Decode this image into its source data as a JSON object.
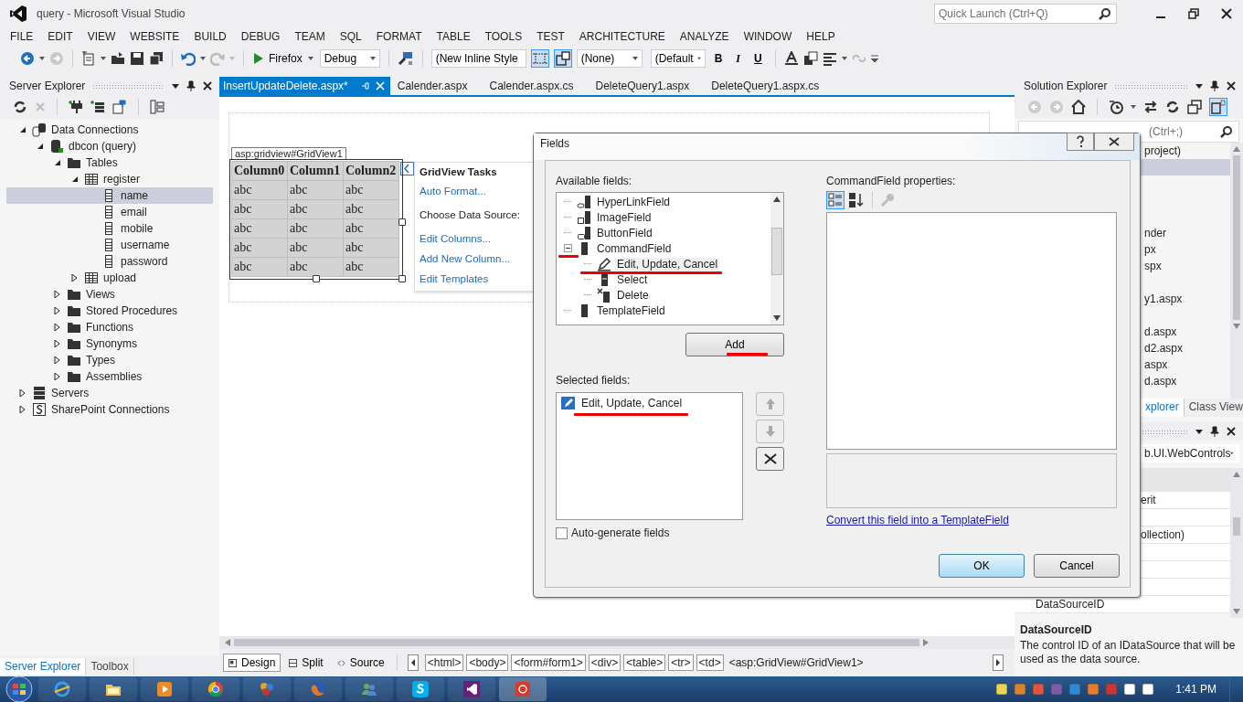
{
  "window": {
    "title": "query - Microsoft Visual Studio",
    "quick_launch": {
      "placeholder": "Quick Launch (Ctrl+Q)"
    }
  },
  "menu": [
    "FILE",
    "EDIT",
    "VIEW",
    "WEBSITE",
    "BUILD",
    "DEBUG",
    "TEAM",
    "SQL",
    "FORMAT",
    "TABLE",
    "TOOLS",
    "TEST",
    "ARCHITECTURE",
    "ANALYZE",
    "WINDOW",
    "HELP"
  ],
  "toolbar": {
    "run_target": "Firefox",
    "configuration": "Debug",
    "style": "(New Inline Style",
    "target_rule": "(None)",
    "font": "(Default",
    "bold": "B",
    "italic": "I",
    "underline": "U"
  },
  "server_explorer": {
    "title": "Server Explorer",
    "tree": [
      {
        "label": "Data Connections",
        "kind": "connections",
        "expanded": true,
        "selected": false,
        "children": [
          {
            "label": "dbcon (query)",
            "kind": "database",
            "expanded": true,
            "selected": false,
            "children": [
              {
                "label": "Tables",
                "kind": "folder",
                "expanded": true,
                "selected": false,
                "children": [
                  {
                    "label": "register",
                    "kind": "table",
                    "expanded": true,
                    "selected": false,
                    "children": [
                      {
                        "label": "name",
                        "kind": "column",
                        "selected": true
                      },
                      {
                        "label": "email",
                        "kind": "column",
                        "selected": false
                      },
                      {
                        "label": "mobile",
                        "kind": "column",
                        "selected": false
                      },
                      {
                        "label": "username",
                        "kind": "column",
                        "selected": false
                      },
                      {
                        "label": "password",
                        "kind": "column",
                        "selected": false
                      }
                    ]
                  },
                  {
                    "label": "upload",
                    "kind": "table",
                    "expanded": false,
                    "selected": false
                  }
                ]
              },
              {
                "label": "Views",
                "kind": "folder",
                "expanded": false,
                "selected": false
              },
              {
                "label": "Stored Procedures",
                "kind": "folder",
                "expanded": false,
                "selected": false
              },
              {
                "label": "Functions",
                "kind": "folder",
                "expanded": false,
                "selected": false
              },
              {
                "label": "Synonyms",
                "kind": "folder",
                "expanded": false,
                "selected": false
              },
              {
                "label": "Types",
                "kind": "folder",
                "expanded": false,
                "selected": false
              },
              {
                "label": "Assemblies",
                "kind": "folder",
                "expanded": false,
                "selected": false
              }
            ]
          }
        ]
      },
      {
        "label": "Servers",
        "kind": "server",
        "expanded": false,
        "selected": false
      },
      {
        "label": "SharePoint Connections",
        "kind": "sharepoint",
        "expanded": false,
        "selected": false
      }
    ]
  },
  "left_tabs": [
    {
      "label": "Server Explorer",
      "selected": true
    },
    {
      "label": "Toolbox",
      "selected": false
    }
  ],
  "tabs": [
    {
      "label": "InsertUpdateDelete.aspx*",
      "selected": true
    },
    {
      "label": "Calender.aspx",
      "selected": false
    },
    {
      "label": "Calender.aspx.cs",
      "selected": false
    },
    {
      "label": "DeleteQuery1.aspx",
      "selected": false
    },
    {
      "label": "DeleteQuery1.aspx.cs",
      "selected": false
    }
  ],
  "designer": {
    "tag": "asp:gridview#GridView1",
    "grid": {
      "columns": [
        "Column0",
        "Column1",
        "Column2"
      ],
      "rows": [
        [
          "abc",
          "abc",
          "abc"
        ],
        [
          "abc",
          "abc",
          "abc"
        ],
        [
          "abc",
          "abc",
          "abc"
        ],
        [
          "abc",
          "abc",
          "abc"
        ],
        [
          "abc",
          "abc",
          "abc"
        ]
      ]
    },
    "tasks": {
      "title": "GridView Tasks",
      "items": [
        {
          "kind": "link",
          "label": "Auto Format..."
        },
        {
          "kind": "dropdown",
          "label": "Choose Data Source:"
        },
        {
          "kind": "link",
          "label": "Edit Columns..."
        },
        {
          "kind": "link",
          "label": "Add New Column..."
        },
        {
          "kind": "link",
          "label": "Edit Templates"
        }
      ]
    }
  },
  "view_buttons": [
    {
      "label": "Design",
      "selected": true
    },
    {
      "label": "Split",
      "selected": false
    },
    {
      "label": "Source",
      "selected": false
    }
  ],
  "breadcrumbs": [
    {
      "label": "<html>",
      "selected": false
    },
    {
      "label": "<body>",
      "selected": false
    },
    {
      "label": "<form#form1>",
      "selected": false
    },
    {
      "label": "<div>",
      "selected": false
    },
    {
      "label": "<table>",
      "selected": false
    },
    {
      "label": "<tr>",
      "selected": false
    },
    {
      "label": "<td>",
      "selected": false
    },
    {
      "label": "<asp:GridView#GridView1>",
      "selected": true
    }
  ],
  "solution_explorer": {
    "title": "Solution Explorer",
    "search": {
      "placeholder": "(Ctrl+;)"
    },
    "items": [
      {
        "label": "project)",
        "selected": false
      },
      {
        "selected": true
      },
      {
        "selected": false
      },
      {
        "selected": false
      },
      {
        "selected": false
      },
      {
        "label": "nder",
        "selected": false
      },
      {
        "label": "px",
        "selected": false
      },
      {
        "label": "spx",
        "selected": false
      },
      {
        "selected": false
      },
      {
        "label": "y1.aspx",
        "selected": false
      },
      {
        "selected": false
      },
      {
        "label": "d.aspx",
        "selected": false
      },
      {
        "label": "d2.aspx",
        "selected": false
      },
      {
        "label": "aspx",
        "selected": false
      },
      {
        "label": "d.aspx",
        "selected": false
      }
    ],
    "tabs": [
      {
        "label": "xplorer",
        "selected": true
      },
      {
        "label": "Class View",
        "selected": false
      }
    ]
  },
  "properties": {
    "object": "b.UI.WebControls",
    "rows": [
      {
        "name": "erit"
      },
      {},
      {
        "name": "ollection)"
      },
      {},
      {},
      {},
      {
        "name": "DataSourceID"
      }
    ],
    "description": {
      "title": "DataSourceID",
      "text": "The control ID of an IDataSource that will be used as the data source."
    }
  },
  "fields_dialog": {
    "title": "Fields",
    "available_label": "Available fields:",
    "available_fields": [
      {
        "label": "HyperLinkField",
        "kind": "hyperlink",
        "selected": false
      },
      {
        "label": "ImageField",
        "kind": "image",
        "selected": false
      },
      {
        "label": "ButtonField",
        "kind": "button",
        "selected": false
      },
      {
        "label": "CommandField",
        "kind": "command",
        "expanded": true,
        "selected": false,
        "children": [
          {
            "label": "Edit, Update, Cancel",
            "kind": "edit",
            "selected": true
          },
          {
            "label": "Select",
            "kind": "select",
            "selected": false
          },
          {
            "label": "Delete",
            "kind": "delete",
            "selected": false
          }
        ]
      },
      {
        "label": "TemplateField",
        "kind": "template",
        "selected": false
      }
    ],
    "add_button": "Add",
    "selected_label": "Selected fields:",
    "selected_fields": [
      {
        "label": "Edit, Update, Cancel",
        "selected": false
      }
    ],
    "auto_generate": {
      "label": "Auto-generate fields",
      "checked": false
    },
    "properties_label": "CommandField properties:",
    "convert_link": "Convert this field into a TemplateField",
    "ok": "OK",
    "cancel": "Cancel"
  },
  "taskbar": {
    "time": "1:41 PM"
  }
}
